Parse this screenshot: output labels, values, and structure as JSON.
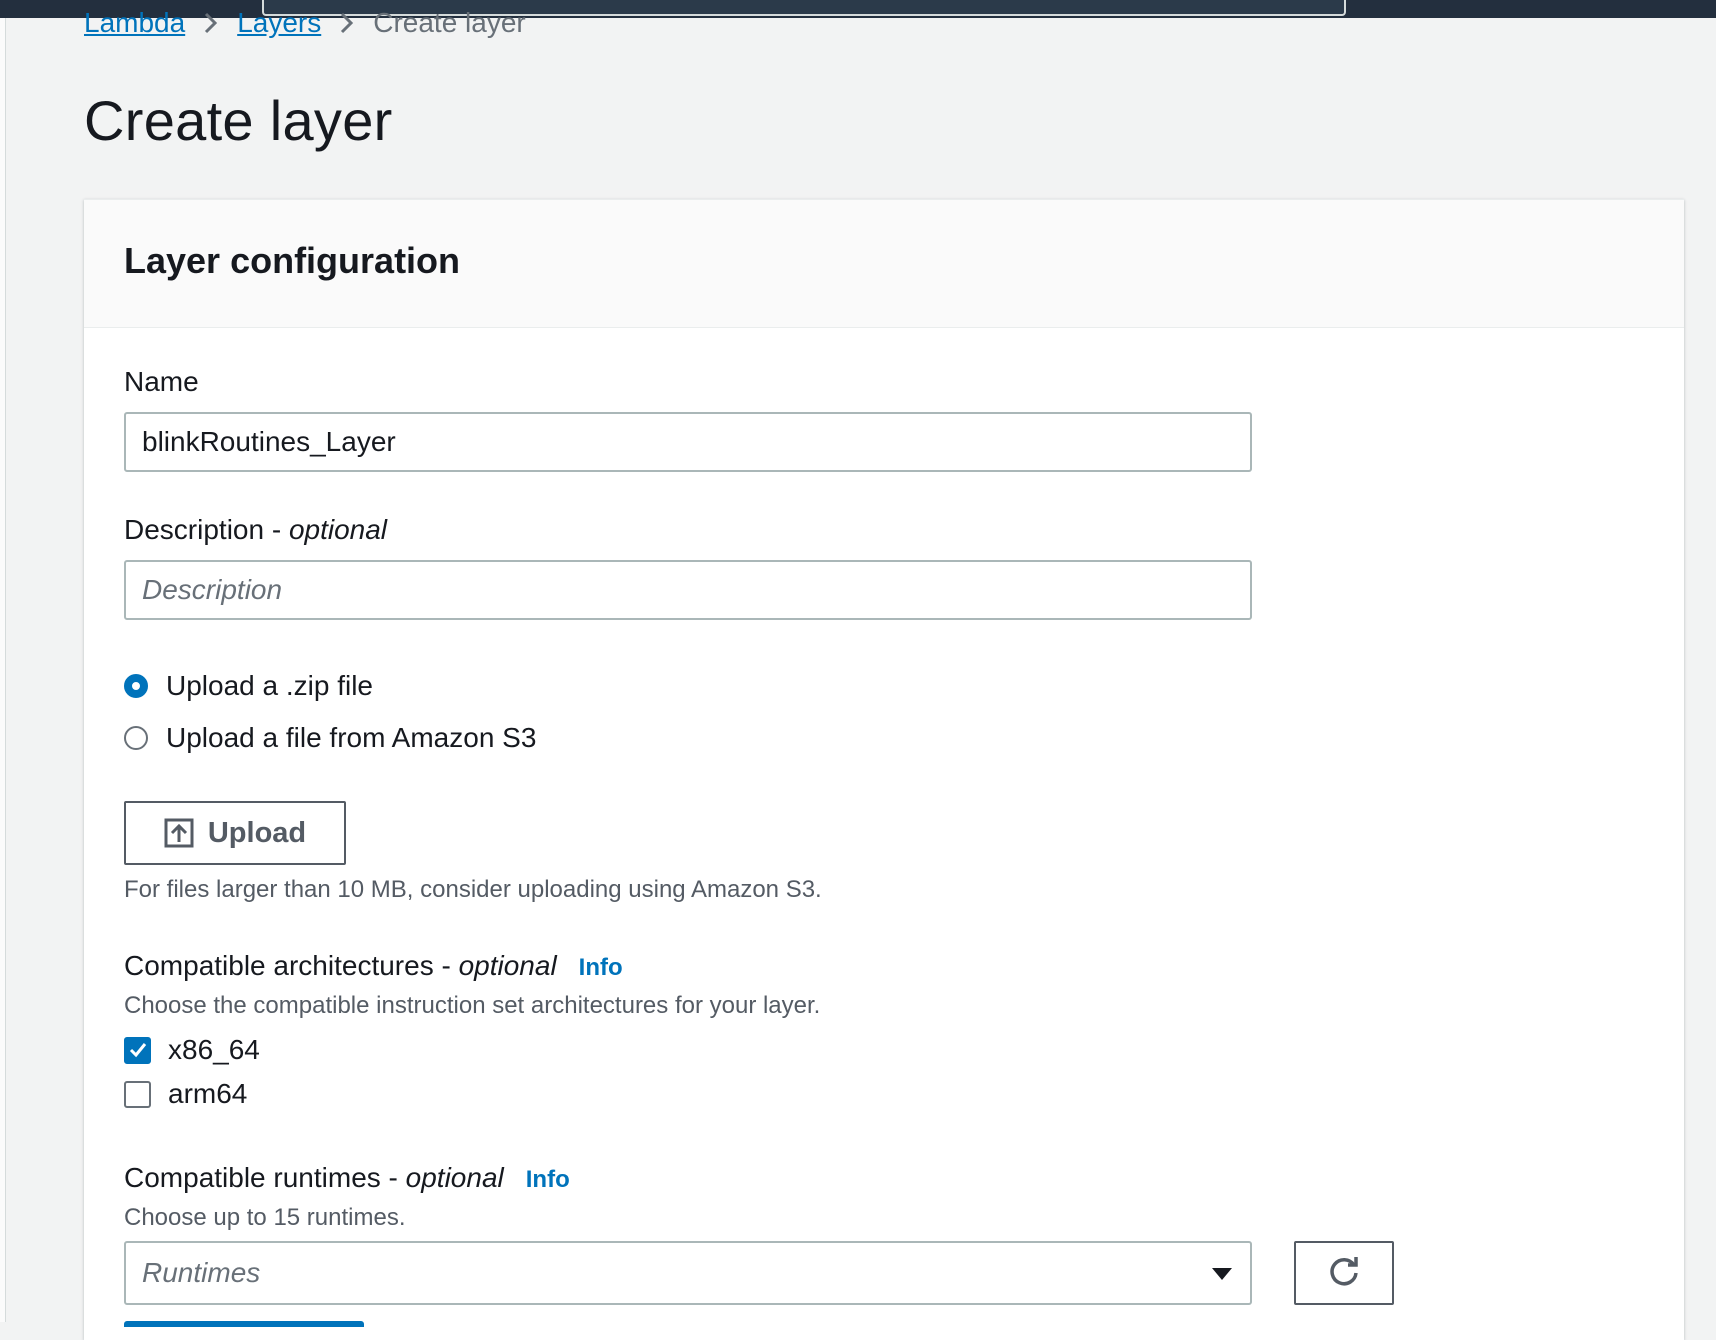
{
  "breadcrumb": {
    "items": [
      "Lambda",
      "Layers"
    ],
    "current": "Create layer"
  },
  "page": {
    "title": "Create layer"
  },
  "panel": {
    "title": "Layer configuration",
    "name": {
      "label": "Name",
      "value": "blinkRoutines_Layer"
    },
    "description": {
      "label": "Description - ",
      "optional": "optional",
      "placeholder": "Description"
    },
    "upload_source": {
      "options": [
        "Upload a .zip file",
        "Upload a file from Amazon S3"
      ],
      "selected": "Upload a .zip file"
    },
    "upload_button": "Upload",
    "upload_hint": "For files larger than 10 MB, consider uploading using Amazon S3.",
    "architectures": {
      "label": "Compatible architectures - ",
      "optional": "optional",
      "info": "Info",
      "description": "Choose the compatible instruction set architectures for your layer.",
      "options": [
        {
          "label": "x86_64",
          "checked": true
        },
        {
          "label": "arm64",
          "checked": false
        }
      ]
    },
    "runtimes": {
      "label": "Compatible runtimes - ",
      "optional": "optional",
      "info": "Info",
      "description": "Choose up to 15 runtimes.",
      "placeholder": "Runtimes"
    }
  },
  "colors": {
    "accent": "#0073bb",
    "header_bar": "#232f3e",
    "background": "#f2f3f3"
  }
}
